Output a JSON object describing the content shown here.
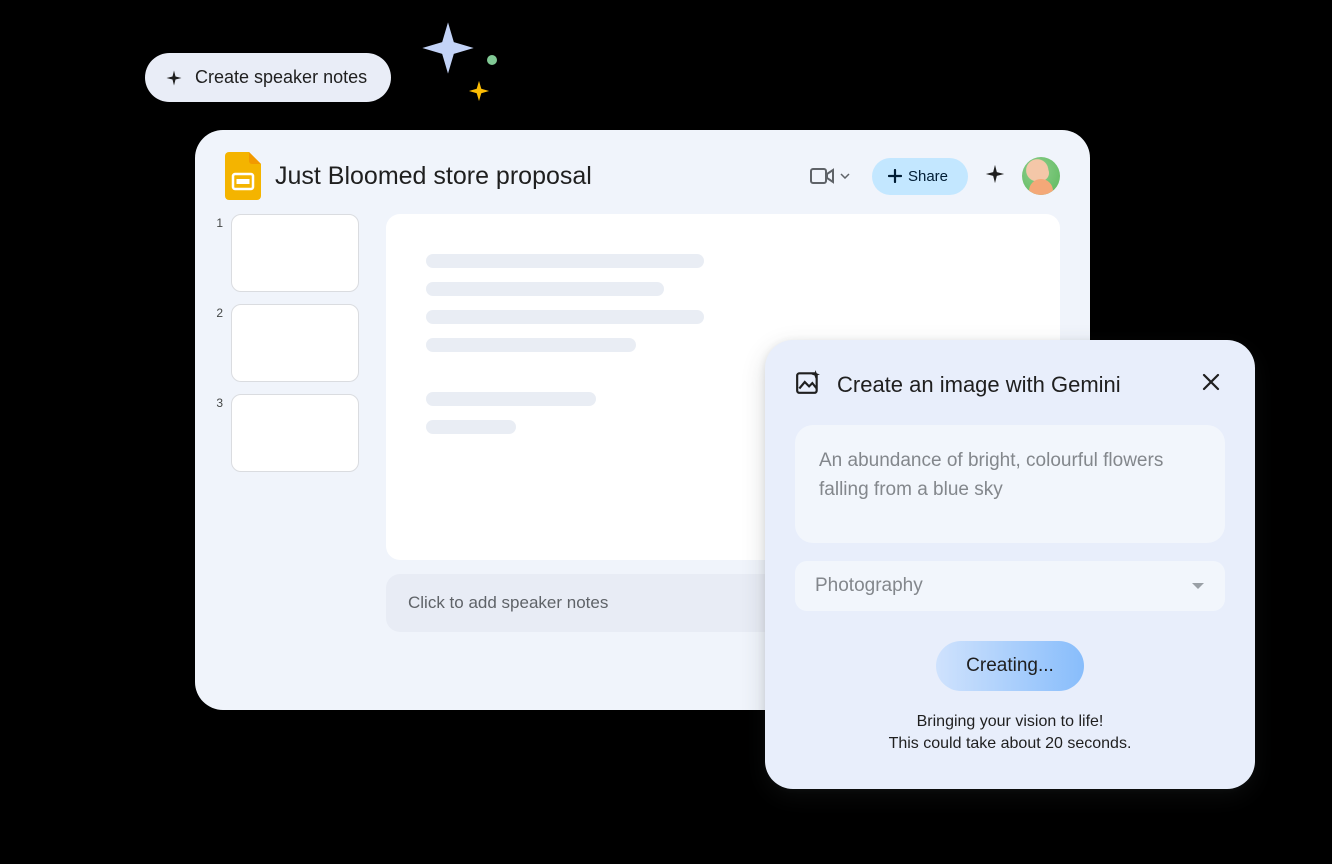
{
  "pill": {
    "label": "Create speaker notes"
  },
  "app": {
    "title": "Just Bloomed store proposal",
    "share_label": "Share",
    "notes_placeholder": "Click to add speaker notes",
    "thumbs": [
      {
        "num": "1"
      },
      {
        "num": "2"
      },
      {
        "num": "3"
      }
    ]
  },
  "gemini": {
    "title": "Create an image with Gemini",
    "prompt": "An abundance of bright, colourful flowers falling from a blue sky",
    "style_selected": "Photography",
    "button_label": "Creating...",
    "status_line1": "Bringing your vision to life!",
    "status_line2": "This could take about 20 seconds."
  },
  "icons": {
    "spark": "spark-icon",
    "video": "video-icon",
    "plus": "plus-icon",
    "close": "close-icon",
    "image_gen": "image-spark-icon",
    "dropdown": "chevron-down-icon"
  }
}
